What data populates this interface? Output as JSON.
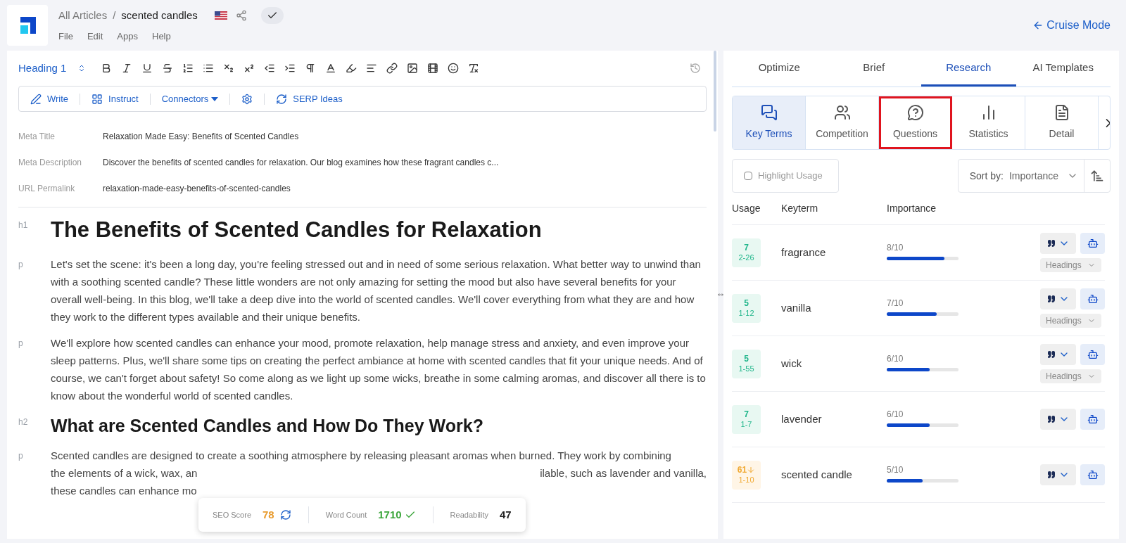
{
  "breadcrumb": {
    "parent": "All Articles",
    "separator": "/",
    "current": "scented candles"
  },
  "menu": [
    "File",
    "Edit",
    "Apps",
    "Help"
  ],
  "cruise_mode": "Cruise Mode",
  "toolbar": {
    "block_style": "Heading 1"
  },
  "ai_bar": [
    {
      "kind": "write",
      "label": "Write"
    },
    {
      "kind": "instruct",
      "label": "Instruct"
    },
    {
      "kind": "connectors",
      "label": "Connectors"
    },
    {
      "kind": "settings"
    },
    {
      "kind": "serp",
      "label": "SERP Ideas"
    }
  ],
  "meta": [
    {
      "label": "Meta Title",
      "value": "Relaxation Made Easy: Benefits of Scented Candles"
    },
    {
      "label": "Meta Description",
      "value": "Discover the benefits of scented candles for relaxation. Our blog examines how these fragrant candles c..."
    },
    {
      "label": "URL Permalink",
      "value": "relaxation-made-easy-benefits-of-scented-candles"
    }
  ],
  "blocks": [
    {
      "tag": "h1",
      "text": "The Benefits of Scented Candles for Relaxation"
    },
    {
      "tag": "p",
      "text": "Let's set the scene: it's been a long day, you're feeling stressed out and in need of some serious relaxation. What better way to unwind than with a soothing scented candle? These little wonders are not only amazing for setting the mood but also have several benefits for your overall well-being. In this blog, we'll take a deep dive into the world of scented candles. We'll cover everything from what they are and how they work to the different types available and their unique benefits."
    },
    {
      "tag": "p",
      "text": "We'll explore how scented candles can enhance your mood, promote relaxation, help manage stress and anxiety, and even improve your sleep patterns. Plus, we'll share some tips on creating the perfect ambiance at home with scented candles that fit your unique needs. And of course, we can't forget about safety! So come along as we light up some wicks, breathe in some calming aromas, and discover all there is to know about the wonderful world of scented candles."
    },
    {
      "tag": "h2",
      "text": "What are Scented Candles and How Do They Work?"
    },
    {
      "tag": "p",
      "lines": [
        [
          "Scented candles are designed to create a soothing atmosphere by releasing pleasant aromas when burned. They work by combining"
        ],
        [
          "the elements of a wick, wax, an",
          "ilable, such as lavender and vanilla,"
        ],
        [
          "these candles can enhance mo"
        ]
      ]
    }
  ],
  "score_bar": [
    {
      "kind": "seo",
      "label": "SEO Score",
      "value": "78"
    },
    {
      "kind": "words",
      "label": "Word Count",
      "value": "1710"
    },
    {
      "kind": "readability",
      "label": "Readability",
      "value": "47"
    }
  ],
  "tabs": [
    {
      "label": "Optimize",
      "selected": false
    },
    {
      "label": "Brief",
      "selected": false
    },
    {
      "label": "Research",
      "selected": true
    },
    {
      "label": "AI Templates",
      "selected": false
    }
  ],
  "subtabs": [
    {
      "kind": "terms",
      "label": "Key Terms",
      "selected": true,
      "highlighted": false
    },
    {
      "kind": "competition",
      "label": "Competition",
      "selected": false,
      "highlighted": false
    },
    {
      "kind": "questions",
      "label": "Questions",
      "selected": false,
      "highlighted": true
    },
    {
      "kind": "statistics",
      "label": "Statistics",
      "selected": false,
      "highlighted": false
    },
    {
      "kind": "details",
      "label": "Detail",
      "selected": false,
      "highlighted": false
    }
  ],
  "highlight_usage": {
    "label": "Highlight Usage",
    "checked": false
  },
  "sort": {
    "label": "Sort by:",
    "value": "Importance"
  },
  "columns": [
    "Usage",
    "Keyterm",
    "Importance"
  ],
  "keyterms": [
    {
      "usage": "7",
      "range": "2-26",
      "over": false,
      "term": "fragrance",
      "score": "8/10",
      "level": 0.8,
      "placement": "Headings"
    },
    {
      "usage": "5",
      "range": "1-12",
      "over": false,
      "term": "vanilla",
      "score": "7/10",
      "level": 0.7,
      "placement": "Headings"
    },
    {
      "usage": "5",
      "range": "1-55",
      "over": false,
      "term": "wick",
      "score": "6/10",
      "level": 0.6,
      "placement": "Headings"
    },
    {
      "usage": "7",
      "range": "1-7",
      "over": false,
      "term": "lavender",
      "score": "6/10",
      "level": 0.6
    },
    {
      "usage": "61",
      "range": "1-10",
      "over": true,
      "term": "scented candle",
      "score": "5/10",
      "level": 0.5
    }
  ]
}
